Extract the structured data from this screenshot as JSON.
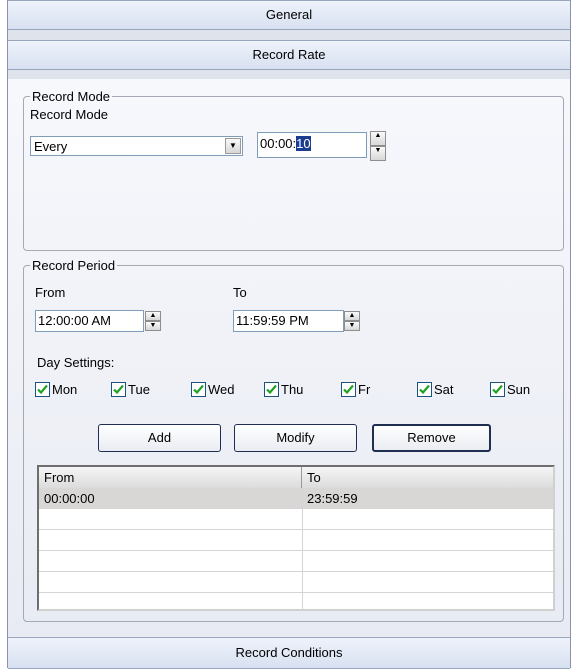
{
  "sections": {
    "general": "General",
    "record_rate": "Record Rate",
    "record_conditions": "Record Conditions"
  },
  "record_mode": {
    "group_title": "Record Mode",
    "label": "Record Mode",
    "mode_value": "Every",
    "interval_prefix": "00:00:",
    "interval_selected": "10"
  },
  "record_period": {
    "group_title": "Record Period",
    "from_label": "From",
    "to_label": "To",
    "from_value": "12:00:00 AM",
    "to_value": "11:59:59 PM",
    "day_settings_label": "Day Settings:",
    "days": [
      {
        "label": "Mon",
        "checked": true
      },
      {
        "label": "Tue",
        "checked": true
      },
      {
        "label": "Wed",
        "checked": true
      },
      {
        "label": "Thu",
        "checked": true
      },
      {
        "label": "Fr",
        "checked": true
      },
      {
        "label": "Sat",
        "checked": true
      },
      {
        "label": "Sun",
        "checked": true
      }
    ],
    "buttons": {
      "add": "Add",
      "modify": "Modify",
      "remove": "Remove"
    },
    "table": {
      "columns": [
        "From",
        "To"
      ],
      "rows": [
        [
          "00:00:00",
          "23:59:59"
        ]
      ]
    }
  },
  "colors": {
    "checkmark": "#21a121",
    "selection": "#1b3d91",
    "header_bg": "#d8e1f1"
  }
}
